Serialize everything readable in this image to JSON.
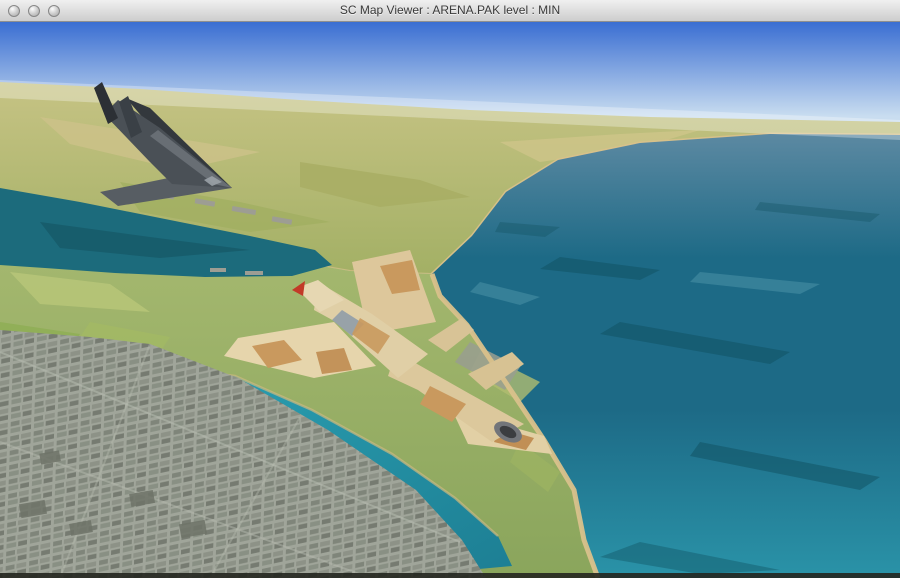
{
  "window": {
    "title": "SC Map Viewer : ARENA.PAK level : MIN",
    "controls": [
      {
        "name": "close"
      },
      {
        "name": "minimize"
      },
      {
        "name": "zoom"
      }
    ]
  },
  "scene": {
    "aircraft": [
      {
        "name": "stealth-fighter",
        "color": "#4a5056"
      },
      {
        "name": "desert-camo-fighter",
        "color": "#e0cfa6",
        "camo": "#c9995e",
        "nose_tip": "#c23a28"
      }
    ],
    "regions": [
      "sky",
      "far-terrain",
      "ocean",
      "upper-bay",
      "near-terrain",
      "center-bay",
      "city"
    ]
  },
  "colors": {
    "sky-top": "#3a6ed2",
    "sky-horizon": "#c9ddf0",
    "ocean-far": "#5c89a2",
    "ocean-deep": "#1d6a86",
    "ocean-near": "#2a93a8",
    "bay-upper": "#1c6b7c",
    "bay-center": "#2ba0b2",
    "bay-center-deep": "#1d7f94",
    "hills-light": "#c6c384",
    "hills-dark": "#a3b065",
    "land-light": "#a9bb72",
    "land-dark": "#8aa55c",
    "beach": "#d9c18b",
    "city-base": "#a0a59a",
    "city-block": "#7f857a",
    "dock": "#9d9d93",
    "stealth-gray": "#4a5056",
    "camo-base": "#e0cfa6",
    "camo-patch": "#c9995e",
    "nose-red": "#c23a28",
    "titlebar-top": "#f0f0f0",
    "titlebar-bottom": "#cdcdcd",
    "title-text": "#3a3a3a"
  }
}
